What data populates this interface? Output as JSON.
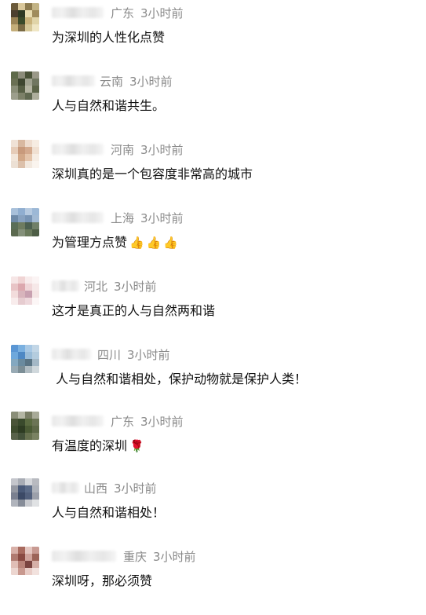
{
  "comments": [
    {
      "region": "广东",
      "time": "3小时前",
      "text": "为深圳的人性化点赞",
      "emoji": []
    },
    {
      "region": "云南",
      "time": "3小时前",
      "text": "人与自然和谐共生。",
      "emoji": []
    },
    {
      "region": "河南",
      "time": "3小时前",
      "text": "深圳真的是一个包容度非常高的城市",
      "emoji": []
    },
    {
      "region": "上海",
      "time": "3小时前",
      "text": "为管理方点赞",
      "emoji": [
        "thumbs-up",
        "thumbs-up",
        "thumbs-up"
      ]
    },
    {
      "region": "河北",
      "time": "3小时前",
      "text": "这才是真正的人与自然两和谐",
      "emoji": []
    },
    {
      "region": "四川",
      "time": "3小时前",
      "text": " 人与自然和谐相处，保护动物就是保护人类！",
      "emoji": []
    },
    {
      "region": "广东",
      "time": "3小时前",
      "text": "有温度的深圳",
      "emoji": [
        "rose"
      ]
    },
    {
      "region": "山西",
      "time": "3小时前",
      "text": "人与自然和谐相处！",
      "emoji": []
    },
    {
      "region": "重庆",
      "time": "3小时前",
      "text": "深圳呀，那必须赞",
      "emoji": []
    }
  ]
}
